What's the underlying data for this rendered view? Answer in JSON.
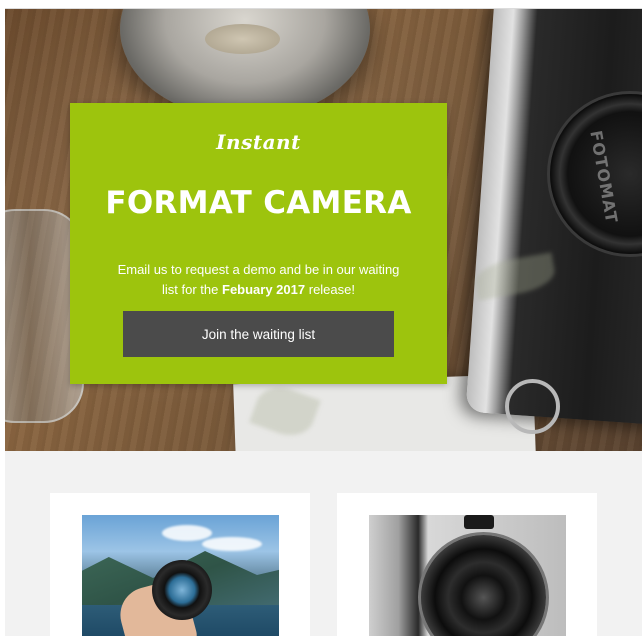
{
  "hero": {
    "brand": "Instant",
    "title": "FORMAT CAMERA",
    "description_part1": "Email us to request a demo and be in our waiting list for the",
    "description_bold": "Febuary 2017",
    "description_part2": "release!",
    "cta_label": "Join the waiting list",
    "lens_text": "FOTOMAT",
    "card_color": "#9dc40d",
    "button_color": "#4b4b4b"
  },
  "products": [
    {
      "name": "product-card-1",
      "image": "hand-holding-lens-photo"
    },
    {
      "name": "product-card-2",
      "image": "camera-lens-closeup-photo"
    }
  ]
}
